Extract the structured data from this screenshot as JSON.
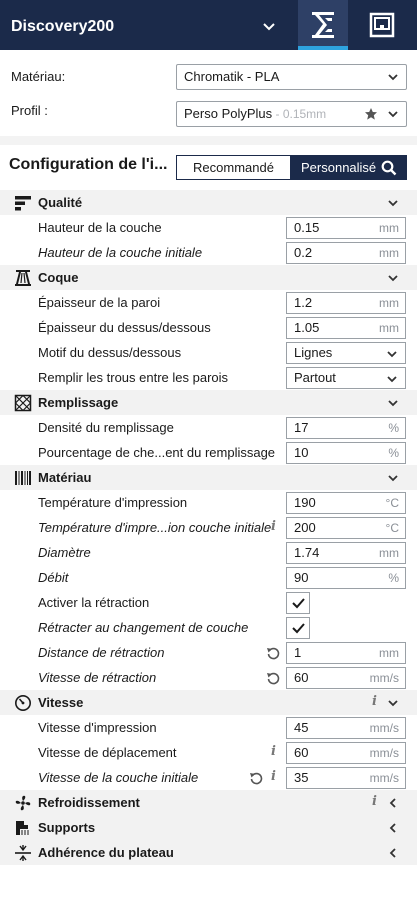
{
  "header": {
    "printer_name": "Discovery200"
  },
  "material": {
    "label": "Matériau:",
    "value": "Chromatik - PLA"
  },
  "profile": {
    "label": "Profil :",
    "value": "Perso PolyPlus",
    "layer": " - 0.15mm"
  },
  "config": {
    "title": "Configuration de l'i...",
    "mode_recommended": "Recommandé",
    "mode_custom": "Personnalisé"
  },
  "categories": {
    "quality": "Qualité",
    "shell": "Coque",
    "infill": "Remplissage",
    "material": "Matériau",
    "speed": "Vitesse",
    "cooling": "Refroidissement",
    "supports": "Supports",
    "adhesion": "Adhérence du plateau"
  },
  "settings": {
    "layer_height": {
      "label": "Hauteur de la couche",
      "value": "0.15",
      "unit": "mm"
    },
    "initial_layer_height": {
      "label": "Hauteur de la couche initiale",
      "value": "0.2",
      "unit": "mm"
    },
    "wall_thickness": {
      "label": "Épaisseur de la paroi",
      "value": "1.2",
      "unit": "mm"
    },
    "top_bottom_thickness": {
      "label": "Épaisseur du dessus/dessous",
      "value": "1.05",
      "unit": "mm"
    },
    "top_bottom_pattern": {
      "label": "Motif du dessus/dessous",
      "value": "Lignes"
    },
    "fill_gaps": {
      "label": "Remplir les trous entre les parois",
      "value": "Partout"
    },
    "infill_density": {
      "label": "Densité du remplissage",
      "value": "17",
      "unit": "%"
    },
    "infill_overlap": {
      "label": "Pourcentage de che...ent du remplissage",
      "value": "10",
      "unit": "%"
    },
    "print_temp": {
      "label": "Température d'impression",
      "value": "190",
      "unit": "°C"
    },
    "print_temp_initial": {
      "label": "Température d'impre...ion couche initiale",
      "value": "200",
      "unit": "°C"
    },
    "diameter": {
      "label": "Diamètre",
      "value": "1.74",
      "unit": "mm"
    },
    "flow": {
      "label": "Débit",
      "value": "90",
      "unit": "%"
    },
    "retraction_enable": {
      "label": "Activer la rétraction"
    },
    "retract_layer_change": {
      "label": "Rétracter au changement de couche"
    },
    "retraction_distance": {
      "label": "Distance de rétraction",
      "value": "1",
      "unit": "mm"
    },
    "retraction_speed": {
      "label": "Vitesse de rétraction",
      "value": "60",
      "unit": "mm/s"
    },
    "print_speed": {
      "label": "Vitesse d'impression",
      "value": "45",
      "unit": "mm/s"
    },
    "travel_speed": {
      "label": "Vitesse de déplacement",
      "value": "60",
      "unit": "mm/s"
    },
    "initial_layer_speed": {
      "label": "Vitesse de la couche initiale",
      "value": "35",
      "unit": "mm/s"
    }
  },
  "info_glyph": "i",
  "colors": {
    "header_bg": "#1b2a4a",
    "accent": "#2ea3df",
    "category_bg": "#f2f2f2"
  }
}
